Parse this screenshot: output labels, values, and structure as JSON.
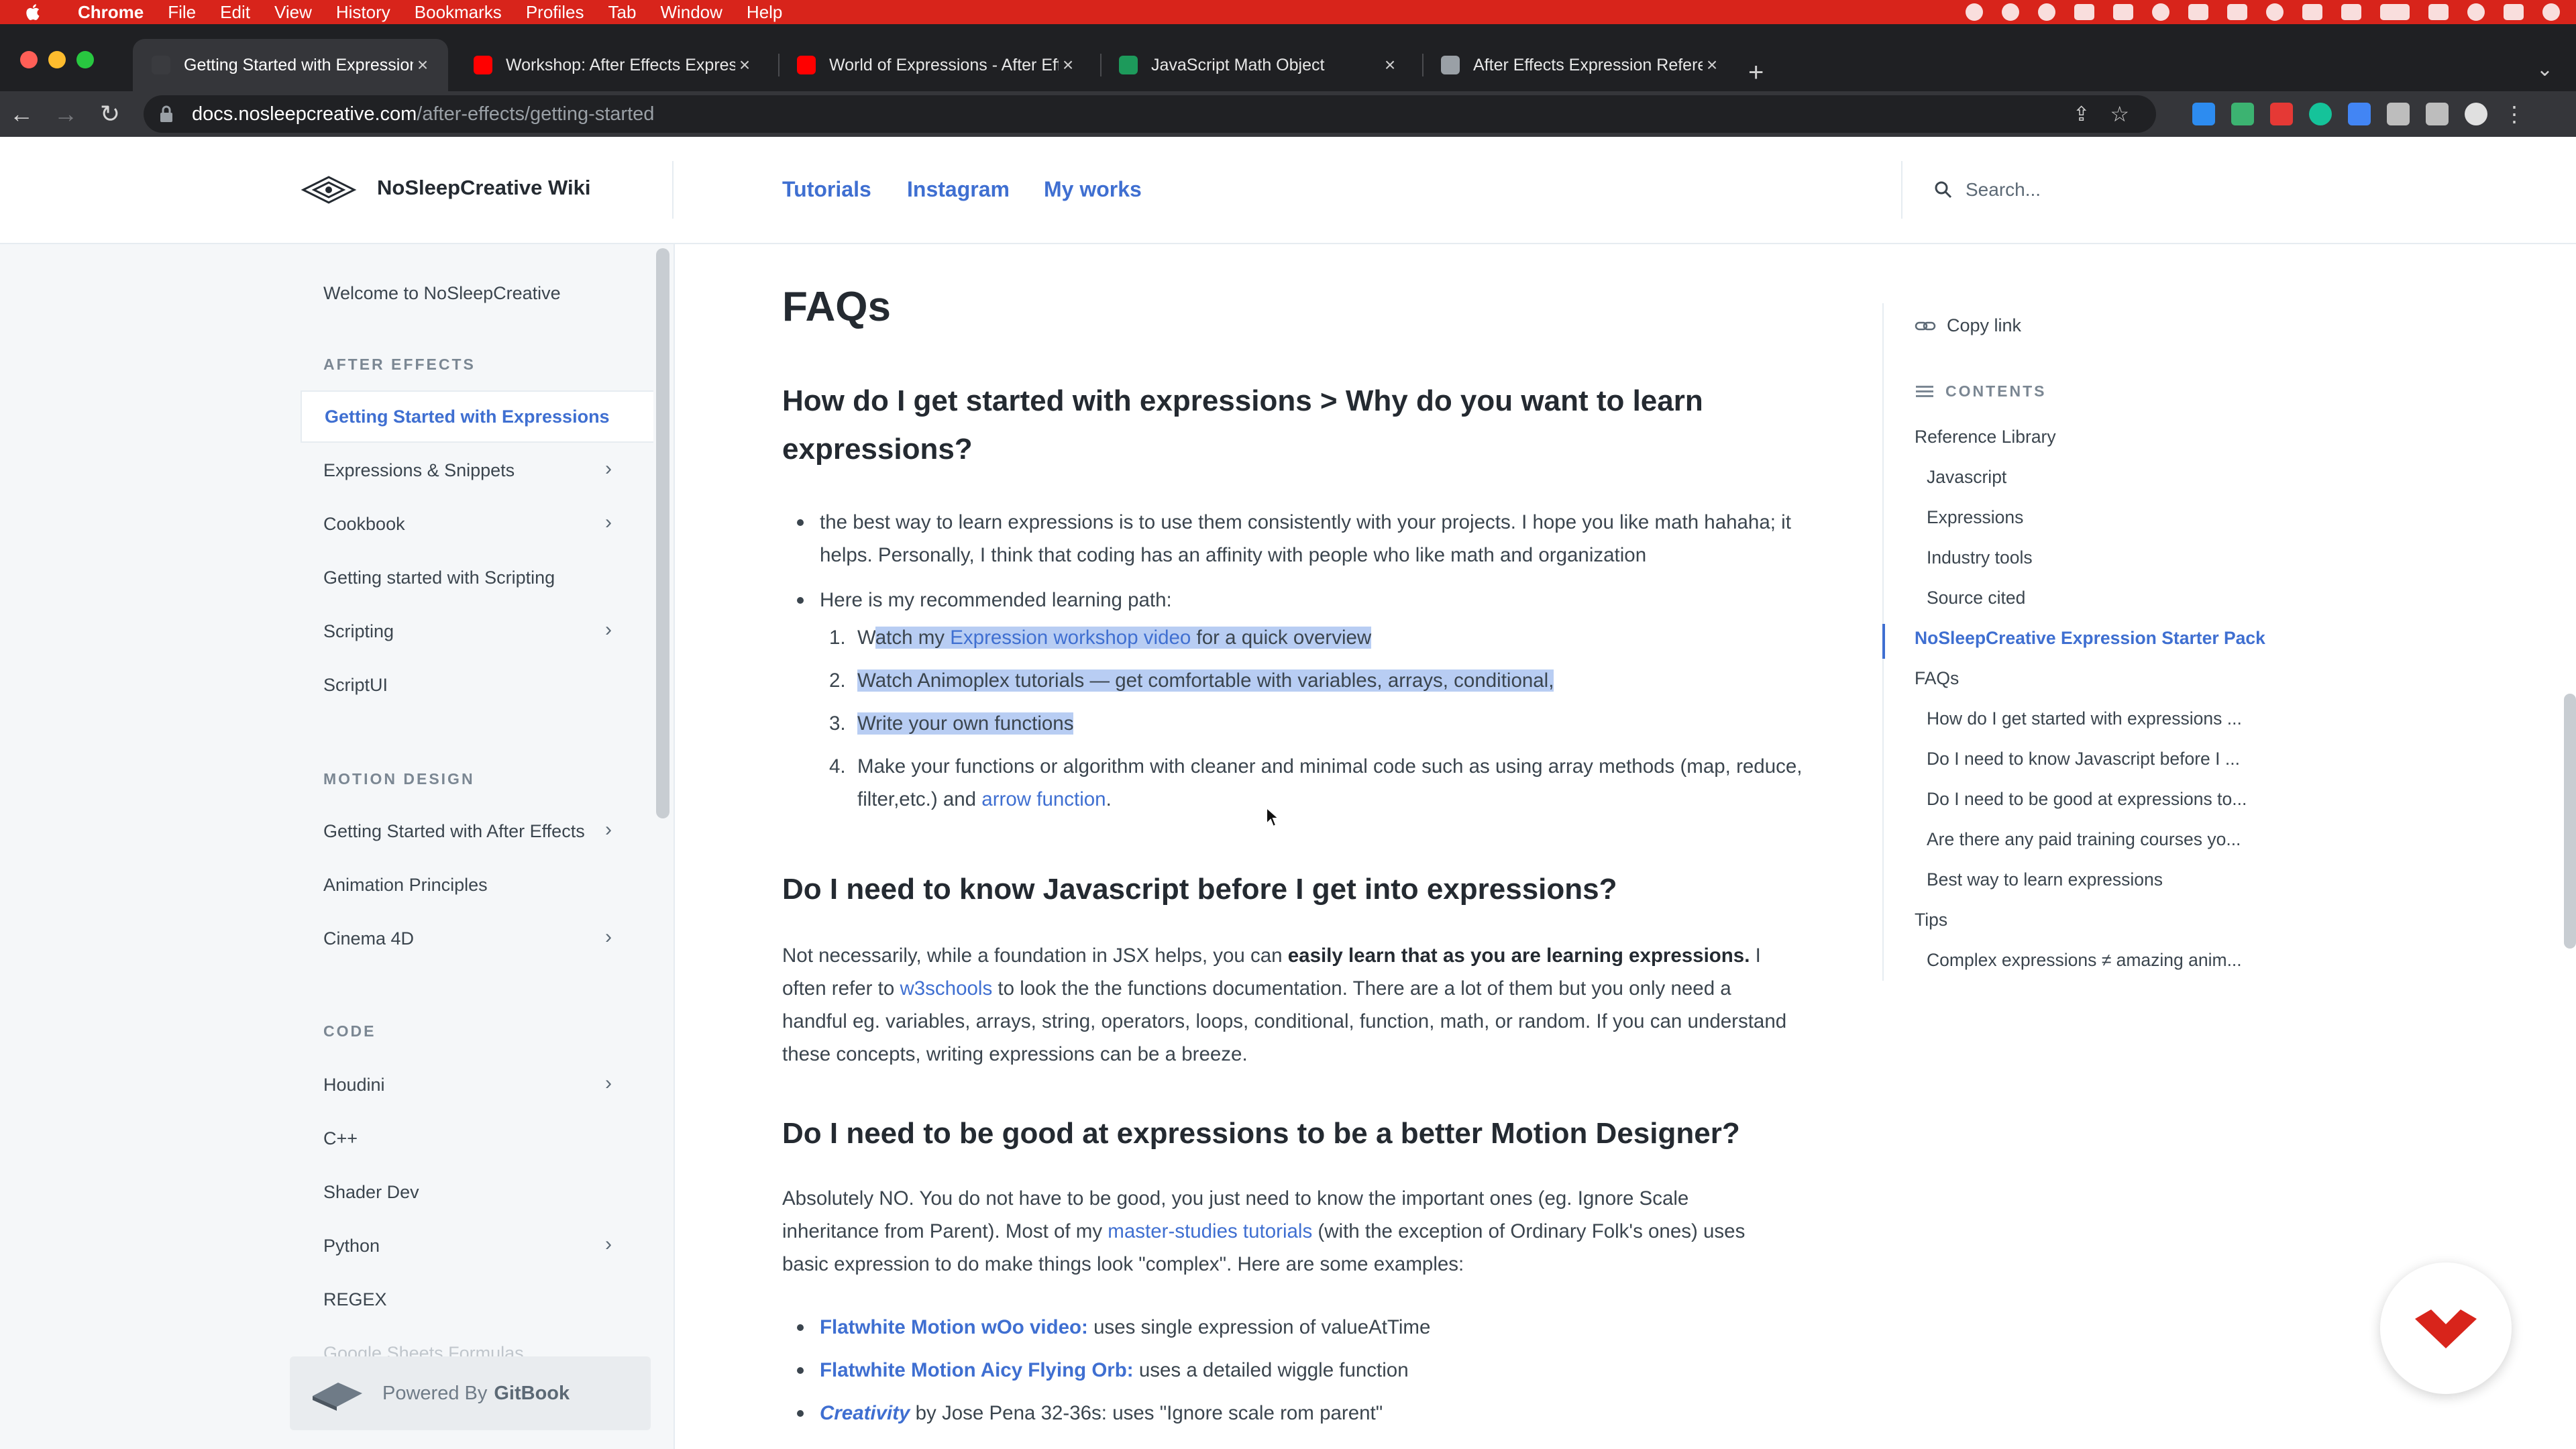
{
  "menubar": {
    "app": "Chrome",
    "items": [
      "File",
      "Edit",
      "View",
      "History",
      "Bookmarks",
      "Profiles",
      "Tab",
      "Window",
      "Help"
    ]
  },
  "tabs": [
    {
      "title": "Getting Started with Expressions",
      "active": true,
      "icon": "gitbook-icon"
    },
    {
      "title": "Workshop: After Effects Expressions",
      "active": false,
      "icon": "youtube-icon"
    },
    {
      "title": "World of Expressions - After Effects",
      "active": false,
      "icon": "youtube-icon"
    },
    {
      "title": "JavaScript Math Object",
      "active": false,
      "icon": "w3schools-icon"
    },
    {
      "title": "After Effects Expression Reference",
      "active": false,
      "icon": "doc-icon"
    }
  ],
  "address": {
    "host": "docs.nosleepcreative.com",
    "path": "/after-effects/getting-started"
  },
  "header": {
    "site_title": "NoSleepCreative Wiki",
    "links": [
      "Tutorials",
      "Instagram",
      "My works"
    ],
    "search_placeholder": "Search..."
  },
  "sidebar": {
    "welcome": "Welcome to NoSleepCreative",
    "section_ae": "AFTER EFFECTS",
    "ae_items": [
      {
        "label": "Getting Started with Expressions",
        "chevron": false,
        "active": true
      },
      {
        "label": "Expressions & Snippets",
        "chevron": true
      },
      {
        "label": "Cookbook",
        "chevron": true
      },
      {
        "label": "Getting started with Scripting",
        "chevron": false
      },
      {
        "label": "Scripting",
        "chevron": true
      },
      {
        "label": "ScriptUI",
        "chevron": false
      }
    ],
    "section_md": "MOTION DESIGN",
    "md_items": [
      {
        "label": "Getting Started with After Effects",
        "chevron": true
      },
      {
        "label": "Animation Principles",
        "chevron": false
      },
      {
        "label": "Cinema 4D",
        "chevron": true
      }
    ],
    "section_code": "CODE",
    "code_items": [
      {
        "label": "Houdini",
        "chevron": true
      },
      {
        "label": "C++",
        "chevron": false
      },
      {
        "label": "Shader Dev",
        "chevron": false
      },
      {
        "label": "Python",
        "chevron": true
      },
      {
        "label": "REGEX",
        "chevron": false
      }
    ],
    "faded_item": "Google Sheets Formulas",
    "powered_by": "Powered By",
    "powered_brand": "GitBook"
  },
  "content": {
    "h1": "FAQs",
    "faq1_title": "How do I get started with expressions > Why do you want to learn expressions?",
    "faq1_bullet1": "the best way to learn expressions is to use them consistently with your projects. I hope you like math hahaha; it helps. Personally, I think that coding has an affinity with people who like math and organization",
    "faq1_bullet2": "Here is my recommended learning path:",
    "path_steps": {
      "s1_pre": "W",
      "s1_hl1": "atch my ",
      "s1_link": "Expression workshop video",
      "s1_hl2": " for a quick overview",
      "s2": "Watch Animoplex tutorials — get comfortable with variables, arrays, conditional, ",
      "s3": "Write your own functions",
      "s4_pre": "Make your functions or algorithm with cleaner and minimal code such as using array methods (map, reduce, filter,etc.) and ",
      "s4_link": "arrow function",
      "s4_post": "."
    },
    "faq2_title": "Do I need to know Javascript before I get into expressions?",
    "faq2_p1": "Not necessarily,  while a foundation in JSX helps, you can ",
    "faq2_bold": "easily learn that as you are learning expressions.",
    "faq2_p2": " I often refer to ",
    "faq2_link": "w3schools",
    "faq2_p3": " to look the the functions documentation. There are a lot of them but you only need a handful eg. variables, arrays, string, operators, loops, conditional, function, math, or random. If you can understand these concepts, writing expressions can be a breeze.",
    "faq3_title": "Do I need to be good at expressions to be a better Motion Designer?",
    "faq3_p1": "Absolutely NO. You do not have to be good, you just need to know the important ones (eg. Ignore Scale inheritance from Parent). Most of my ",
    "faq3_link": "master-studies tutorials",
    "faq3_p2": " (with the exception of Ordinary Folk's ones) uses basic expression to do make things look \"complex\". Here are some examples:",
    "examples": [
      {
        "link": "Flatwhite Motion wOo video:",
        "text": " uses single expression of valueAtTime",
        "italic": false
      },
      {
        "link": "Flatwhite Motion Aicy Flying Orb:",
        "text": " uses a detailed wiggle function",
        "italic": false
      },
      {
        "link": "Creativity",
        "text": " by Jose Pena 32-36s: uses \"Ignore scale rom parent\"",
        "italic": true
      }
    ]
  },
  "toc": {
    "copy_link": "Copy link",
    "heading": "CONTENTS",
    "items": [
      {
        "label": "Reference Library",
        "level": 1
      },
      {
        "label": "Javascript",
        "level": 2
      },
      {
        "label": "Expressions",
        "level": 2
      },
      {
        "label": "Industry tools",
        "level": 2
      },
      {
        "label": "Source cited",
        "level": 2
      },
      {
        "label": "NoSleepCreative Expression Starter Pack",
        "level": 1,
        "active": true
      },
      {
        "label": "FAQs",
        "level": 1
      },
      {
        "label": "How do I get started with expressions ...",
        "level": 2
      },
      {
        "label": "Do I need to know Javascript before I ...",
        "level": 2
      },
      {
        "label": "Do I need to be good at expressions to...",
        "level": 2
      },
      {
        "label": "Are there any paid training courses yo...",
        "level": 2
      },
      {
        "label": "Best way to learn expressions",
        "level": 2
      },
      {
        "label": "Tips",
        "level": 1
      },
      {
        "label": "Complex expressions ≠ amazing anim...",
        "level": 2
      }
    ]
  },
  "colors": {
    "menubar": "#d8241b",
    "accent": "#3f6fd1",
    "highlight": "#b8cdf3"
  }
}
